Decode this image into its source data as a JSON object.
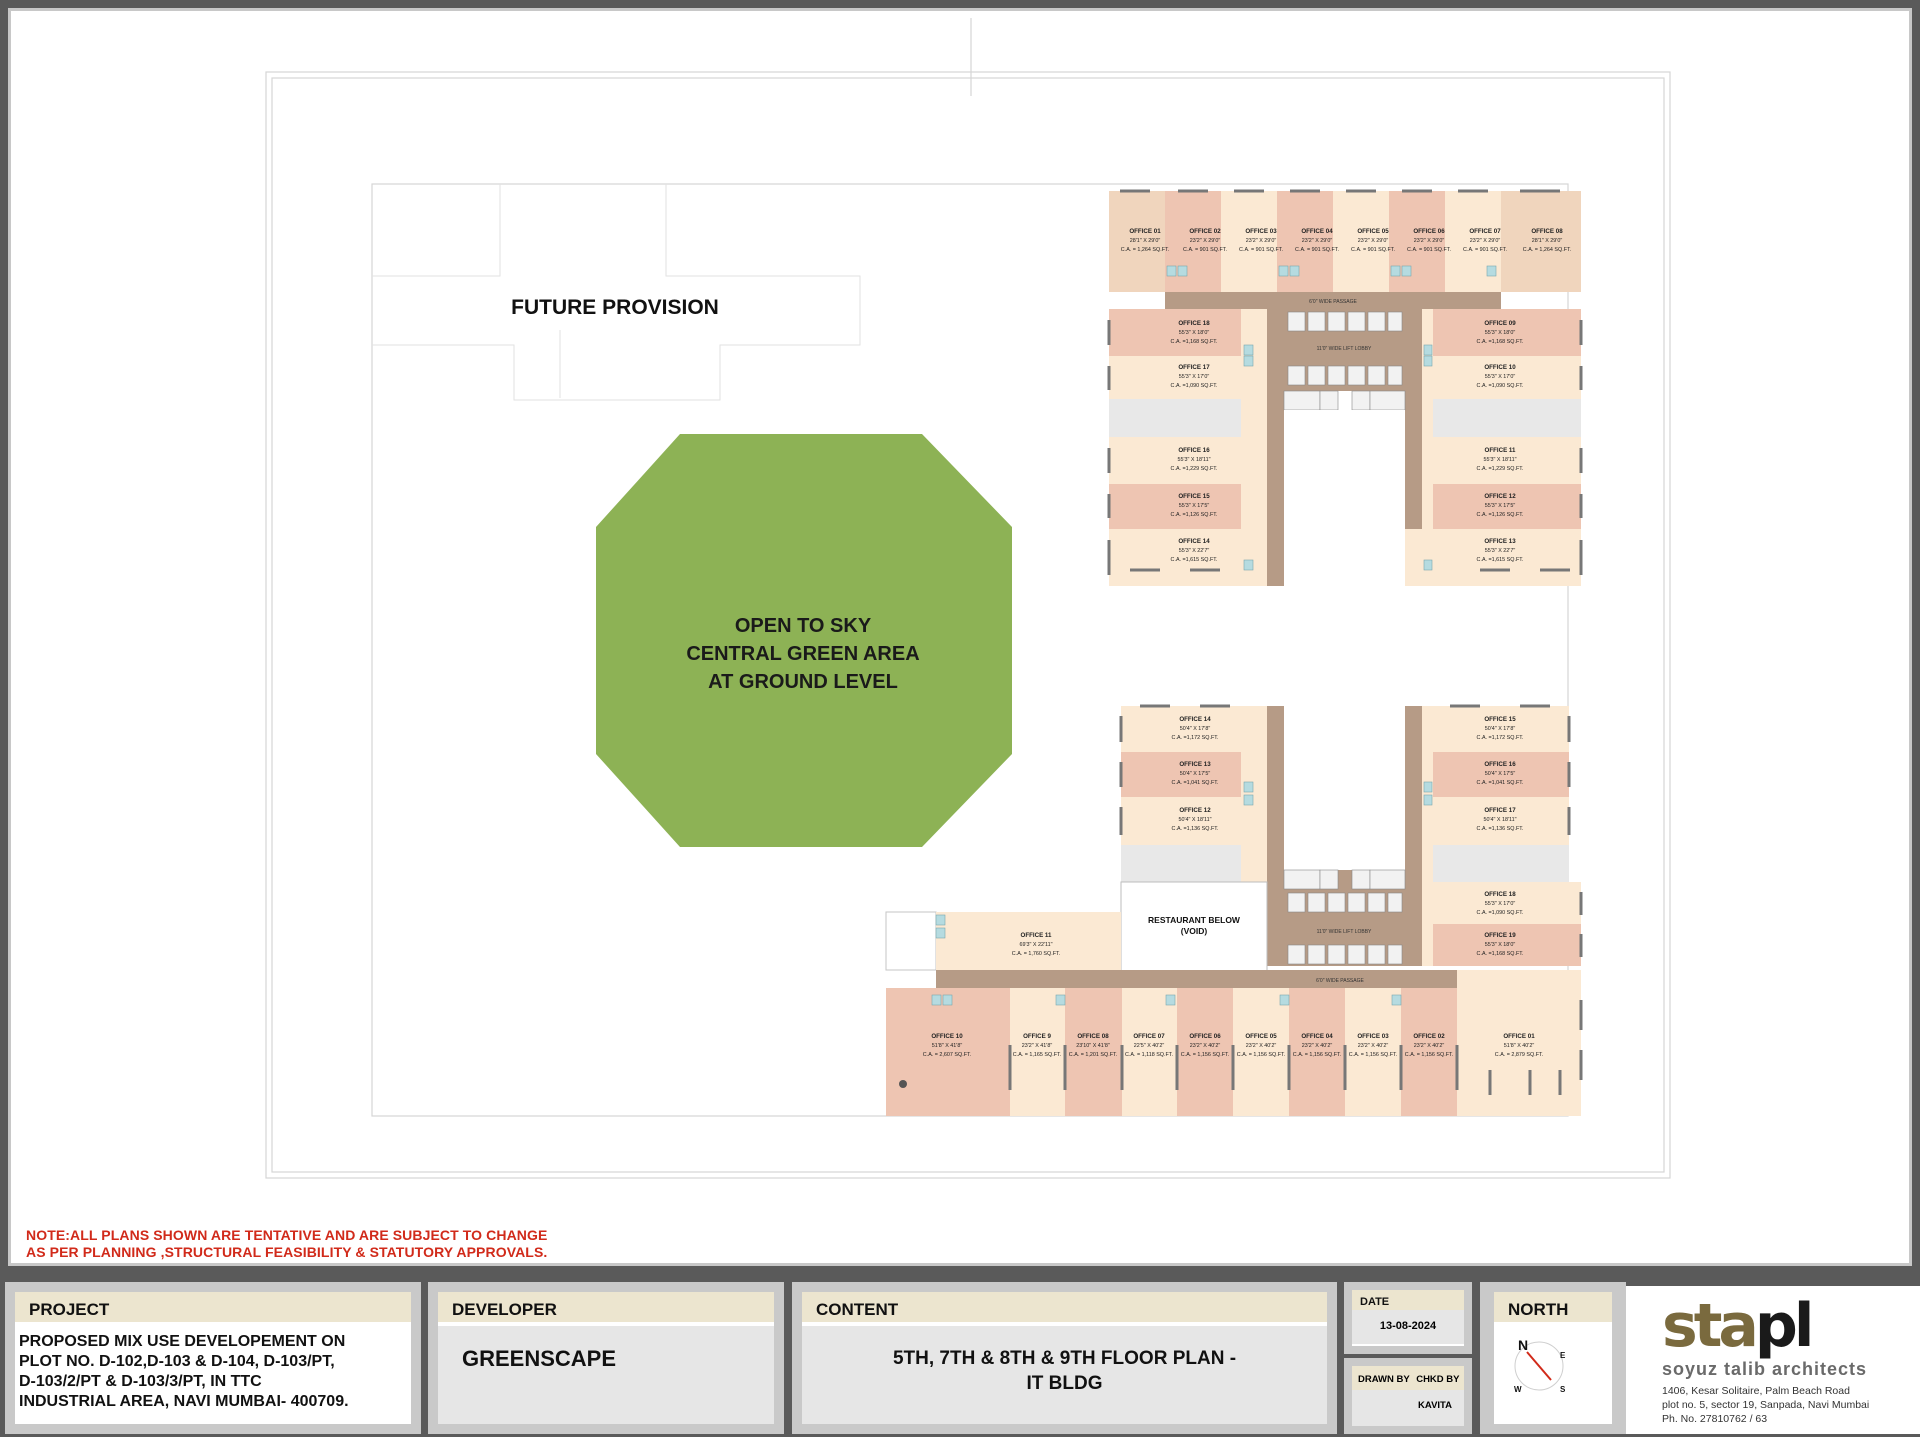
{
  "plan": {
    "future_provision": "FUTURE PROVISION",
    "green_area": [
      "OPEN TO SKY",
      "CENTRAL GREEN AREA",
      "AT GROUND LEVEL"
    ],
    "restaurant": [
      "RESTAURANT BELOW",
      "(VOID)"
    ],
    "north_block": [
      {
        "id": "OFFICE 01",
        "size": "28'1\" X 29'0\"",
        "ca": "C.A. = 1,264 SQ.FT."
      },
      {
        "id": "OFFICE 02",
        "size": "23'2\" X 29'0\"",
        "ca": "C.A. = 901 SQ.FT."
      },
      {
        "id": "OFFICE 03",
        "size": "23'2\" X 29'0\"",
        "ca": "C.A. = 901 SQ.FT."
      },
      {
        "id": "OFFICE 04",
        "size": "23'2\" X 29'0\"",
        "ca": "C.A. = 901 SQ.FT."
      },
      {
        "id": "OFFICE 05",
        "size": "23'2\" X 29'0\"",
        "ca": "C.A. = 901 SQ.FT."
      },
      {
        "id": "OFFICE 06",
        "size": "23'2\" X 29'0\"",
        "ca": "C.A. = 901 SQ.FT."
      },
      {
        "id": "OFFICE 07",
        "size": "23'2\" X 29'0\"",
        "ca": "C.A. = 901 SQ.FT."
      },
      {
        "id": "OFFICE 08",
        "size": "28'1\" X 29'0\"",
        "ca": "C.A. = 1,264 SQ.FT."
      },
      {
        "id": "OFFICE 18",
        "size": "55'3\" X 18'0\"",
        "ca": "C.A. =1,168 SQ.FT."
      },
      {
        "id": "OFFICE 17",
        "size": "55'3\" X 17'0\"",
        "ca": "C.A. =1,090 SQ.FT."
      },
      {
        "id": "OFFICE 16",
        "size": "55'3\" X 18'11\"",
        "ca": "C.A. =1,229 SQ.FT."
      },
      {
        "id": "OFFICE 15",
        "size": "55'3\" X 17'5\"",
        "ca": "C.A. =1,126 SQ.FT."
      },
      {
        "id": "OFFICE 14",
        "size": "55'3\" X 22'7\"",
        "ca": "C.A. =1,615 SQ.FT."
      },
      {
        "id": "OFFICE 09",
        "size": "55'3\" X 18'0\"",
        "ca": "C.A. =1,168 SQ.FT."
      },
      {
        "id": "OFFICE 10",
        "size": "55'3\" X 17'0\"",
        "ca": "C.A. =1,090 SQ.FT."
      },
      {
        "id": "OFFICE 11",
        "size": "55'3\" X 18'11\"",
        "ca": "C.A. =1,229 SQ.FT."
      },
      {
        "id": "OFFICE 12",
        "size": "55'3\" X 17'5\"",
        "ca": "C.A. =1,126 SQ.FT."
      },
      {
        "id": "OFFICE 13",
        "size": "55'3\" X 22'7\"",
        "ca": "C.A. =1,615 SQ.FT."
      }
    ],
    "south_block": [
      {
        "id": "OFFICE 14",
        "size": "50'4\" X 17'8\"",
        "ca": "C.A. =1,172 SQ.FT."
      },
      {
        "id": "OFFICE 13",
        "size": "50'4\" X 17'5\"",
        "ca": "C.A. =1,041 SQ.FT."
      },
      {
        "id": "OFFICE 12",
        "size": "50'4\" X 18'11\"",
        "ca": "C.A. =1,136 SQ.FT."
      },
      {
        "id": "OFFICE 15",
        "size": "50'4\" X 17'8\"",
        "ca": "C.A. =1,172 SQ.FT."
      },
      {
        "id": "OFFICE 16",
        "size": "50'4\" X 17'5\"",
        "ca": "C.A. =1,041 SQ.FT."
      },
      {
        "id": "OFFICE 17",
        "size": "50'4\" X 18'11\"",
        "ca": "C.A. =1,136 SQ.FT."
      },
      {
        "id": "OFFICE 18",
        "size": "55'3\" X 17'0\"",
        "ca": "C.A. =1,090 SQ.FT."
      },
      {
        "id": "OFFICE 19",
        "size": "55'3\" X 18'0\"",
        "ca": "C.A. =1,168 SQ.FT."
      },
      {
        "id": "OFFICE 11",
        "size": "69'3\" X 22'11\"",
        "ca": "C.A. = 1,760 SQ.FT."
      },
      {
        "id": "OFFICE 10",
        "size": "51'8\" X 41'8\"",
        "ca": "C.A. = 2,607 SQ.FT."
      },
      {
        "id": "OFFICE 9",
        "size": "23'2\" X 41'8\"",
        "ca": "C.A. = 1,165 SQ.FT."
      },
      {
        "id": "OFFICE 08",
        "size": "23'10\" X 41'8\"",
        "ca": "C.A. = 1,201 SQ.FT."
      },
      {
        "id": "OFFICE 07",
        "size": "22'5\" X 40'2\"",
        "ca": "C.A. = 1,118 SQ.FT."
      },
      {
        "id": "OFFICE 06",
        "size": "23'2\" X 40'2\"",
        "ca": "C.A. = 1,156 SQ.FT."
      },
      {
        "id": "OFFICE 05",
        "size": "23'2\" X 40'2\"",
        "ca": "C.A. = 1,156 SQ.FT."
      },
      {
        "id": "OFFICE 04",
        "size": "23'2\" X 40'2\"",
        "ca": "C.A. = 1,156 SQ.FT."
      },
      {
        "id": "OFFICE 03",
        "size": "23'2\" X 40'2\"",
        "ca": "C.A. = 1,156 SQ.FT."
      },
      {
        "id": "OFFICE 02",
        "size": "23'2\" X 40'2\"",
        "ca": "C.A. = 1,156 SQ.FT."
      },
      {
        "id": "OFFICE 01",
        "size": "51'8\" X 40'2\"",
        "ca": "C.A. = 2,879 SQ.FT."
      }
    ],
    "passage": "6'0\" WIDE PASSAGE",
    "lift_lobby": "11'0\" WIDE LIFT LOBBY",
    "colors": {
      "salmon": "#eec5b2",
      "cream": "#fbe9d3",
      "corridor": "#b69b86",
      "green": "#8db255",
      "wash": "#b5dbe0",
      "white": "#ffffff"
    }
  },
  "note": [
    "NOTE:ALL PLANS SHOWN ARE TENTATIVE  AND ARE SUBJECT TO CHANGE",
    "AS PER PLANNING ,STRUCTURAL FEASIBILITY & STATUTORY APPROVALS."
  ],
  "title_block": {
    "project_label": "PROJECT",
    "project_text": [
      "PROPOSED MIX USE DEVELOPEMENT ON",
      "PLOT NO. D-102,D-103 & D-104, D-103/PT,",
      "D-103/2/PT & D-103/3/PT, IN TTC",
      "INDUSTRIAL AREA, NAVI MUMBAI- 400709."
    ],
    "developer_label": "DEVELOPER",
    "developer": "GREENSCAPE",
    "content_label": "CONTENT",
    "content": [
      "5TH, 7TH & 8TH & 9TH  FLOOR PLAN -",
      "IT BLDG"
    ],
    "date_label": "DATE",
    "date": "13-08-2024",
    "drawn_label": "DRAWN BY",
    "chkd_label": "CHKD BY",
    "chkd_value": "KAVITA",
    "north_label": "NORTH",
    "compass": {
      "n": "N",
      "e": "E",
      "w": "W",
      "s": "S"
    }
  },
  "architect": {
    "logo_a": "sta",
    "logo_b": "pl",
    "name": "soyuz  talib  architects",
    "address": [
      "1406, Kesar Solitaire, Palm Beach Road",
      "plot no. 5, sector 19, Sanpada, Navi Mumbai",
      "Ph. No. 27810762 / 63"
    ]
  }
}
